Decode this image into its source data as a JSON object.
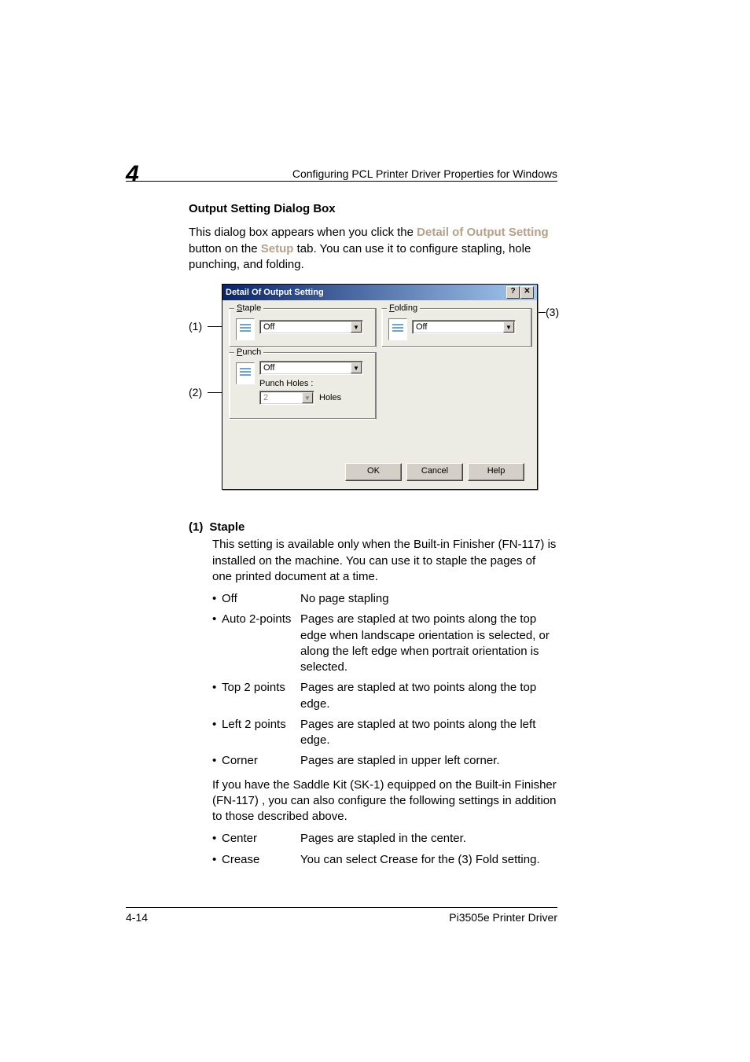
{
  "header": {
    "chapter": "4",
    "title": "Configuring PCL Printer Driver Properties for Windows"
  },
  "body": {
    "subhead": "Output Setting Dialog Box",
    "intro_1": "This dialog box appears when you click the ",
    "intro_link1": "Detail of Output Setting",
    "intro_2": " button on the ",
    "intro_link2": "Setup",
    "intro_3": " tab. You can use it to configure stapling, hole punching, and folding."
  },
  "dialog": {
    "title": "Detail Of Output Setting",
    "help_btn": "?",
    "close_btn": "✕",
    "staple": {
      "legend": "Staple",
      "value": "Off"
    },
    "folding": {
      "legend": "Folding",
      "value": "Off"
    },
    "punch": {
      "legend": "Punch",
      "value": "Off",
      "holes_label": "Punch Holes :",
      "holes_value": "2",
      "holes_unit": "Holes"
    },
    "ok": "OK",
    "cancel": "Cancel",
    "help": "Help"
  },
  "callouts": {
    "c1": "(1)",
    "c2": "(2)",
    "c3": "(3)"
  },
  "sections": {
    "num": "(1)",
    "title": "Staple",
    "desc": "This setting is available only when the Built-in Finisher (FN-117) is installed on the machine. You can use it to staple the pages of one printed document at a time.",
    "options1": [
      {
        "name": "Off",
        "desc": "No page stapling"
      },
      {
        "name": "Auto 2-points",
        "desc": "Pages are stapled at two points along the top edge when landscape orientation is selected, or along the left edge when portrait orientation is selected."
      },
      {
        "name": "Top 2 points",
        "desc": "Pages are stapled at two points along the top edge."
      },
      {
        "name": "Left 2 points",
        "desc": "Pages are stapled at two points along the left edge."
      },
      {
        "name": "Corner",
        "desc": "Pages are stapled in upper left corner."
      }
    ],
    "extra": "If you have the Saddle Kit (SK-1) equipped on the Built-in Finisher (FN-117) , you can also configure the following settings in addition to those described above.",
    "options2": [
      {
        "name": "Center",
        "desc": "Pages are stapled in the center."
      },
      {
        "name": "Crease",
        "desc": "You can select Crease for the (3) Fold setting."
      }
    ]
  },
  "footer": {
    "left": "4-14",
    "right": "Pi3505e Printer Driver"
  }
}
